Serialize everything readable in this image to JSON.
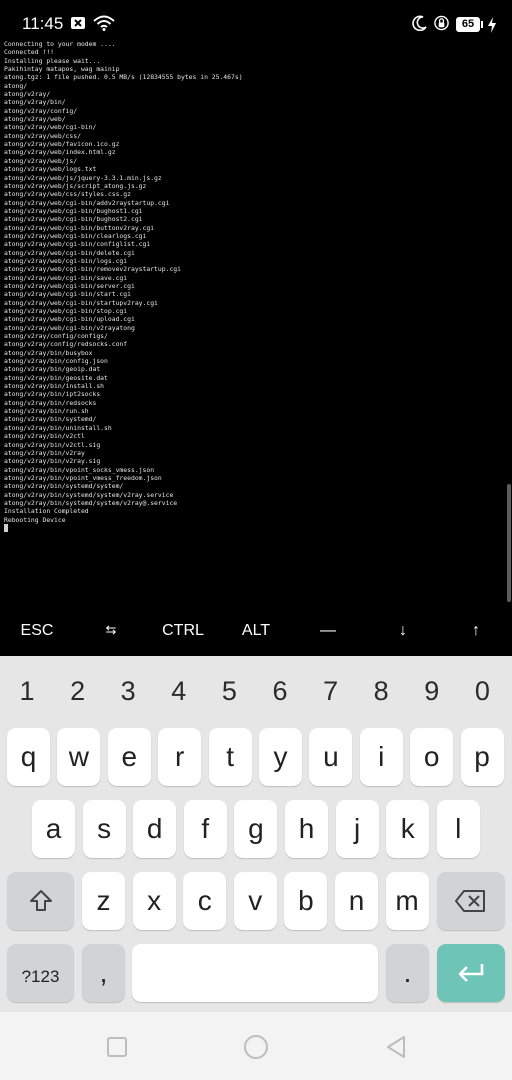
{
  "status_bar": {
    "time": "11:45",
    "battery": "65",
    "icons": [
      "sim-off-icon",
      "wifi-icon",
      "moon-icon",
      "rotation-lock-icon",
      "battery-icon",
      "charging-icon"
    ]
  },
  "terminal": {
    "lines": [
      "Connecting to your modem ....",
      "Connected !!!",
      "Installing please wait...",
      "Pakihintay matapos, wag mainip",
      "atong.tgz: 1 file pushed. 0.5 MB/s (12834555 bytes in 25.467s)",
      "atong/",
      "atong/v2ray/",
      "atong/v2ray/bin/",
      "atong/v2ray/config/",
      "atong/v2ray/web/",
      "atong/v2ray/web/cgi-bin/",
      "atong/v2ray/web/css/",
      "atong/v2ray/web/favicon.ico.gz",
      "atong/v2ray/web/index.html.gz",
      "atong/v2ray/web/js/",
      "atong/v2ray/web/logs.txt",
      "atong/v2ray/web/js/jquery-3.3.1.min.js.gz",
      "atong/v2ray/web/js/script_atong.js.gz",
      "atong/v2ray/web/css/styles.css.gz",
      "atong/v2ray/web/cgi-bin/addv2raystartup.cgi",
      "atong/v2ray/web/cgi-bin/bughost1.cgi",
      "atong/v2ray/web/cgi-bin/bughost2.cgi",
      "atong/v2ray/web/cgi-bin/buttonv2ray.cgi",
      "atong/v2ray/web/cgi-bin/clearlogs.cgi",
      "atong/v2ray/web/cgi-bin/configlist.cgi",
      "atong/v2ray/web/cgi-bin/delete.cgi",
      "atong/v2ray/web/cgi-bin/logs.cgi",
      "atong/v2ray/web/cgi-bin/removev2raystartup.cgi",
      "atong/v2ray/web/cgi-bin/save.cgi",
      "atong/v2ray/web/cgi-bin/server.cgi",
      "atong/v2ray/web/cgi-bin/start.cgi",
      "atong/v2ray/web/cgi-bin/startupv2ray.cgi",
      "atong/v2ray/web/cgi-bin/stop.cgi",
      "atong/v2ray/web/cgi-bin/upload.cgi",
      "atong/v2ray/web/cgi-bin/v2rayatong",
      "atong/v2ray/config/configs/",
      "atong/v2ray/config/redsocks.conf",
      "atong/v2ray/bin/busybox",
      "atong/v2ray/bin/config.json",
      "atong/v2ray/bin/geoip.dat",
      "atong/v2ray/bin/geosite.dat",
      "atong/v2ray/bin/install.sh",
      "atong/v2ray/bin/ipt2socks",
      "atong/v2ray/bin/redsocks",
      "atong/v2ray/bin/run.sh",
      "atong/v2ray/bin/systemd/",
      "atong/v2ray/bin/uninstall.sh",
      "atong/v2ray/bin/v2ctl",
      "atong/v2ray/bin/v2ctl.sig",
      "atong/v2ray/bin/v2ray",
      "atong/v2ray/bin/v2ray.sig",
      "atong/v2ray/bin/vpoint_socks_vmess.json",
      "atong/v2ray/bin/vpoint_vmess_freedom.json",
      "atong/v2ray/bin/systemd/system/",
      "atong/v2ray/bin/systemd/system/v2ray.service",
      "atong/v2ray/bin/systemd/system/v2ray@.service",
      "Installation Completed",
      "Rebooting Device"
    ]
  },
  "extra_keys": {
    "esc": "ESC",
    "tab": "⇆",
    "ctrl": "CTRL",
    "alt": "ALT",
    "dash": "—",
    "down": "↓",
    "up": "↑"
  },
  "keyboard": {
    "numbers": [
      "1",
      "2",
      "3",
      "4",
      "5",
      "6",
      "7",
      "8",
      "9",
      "0"
    ],
    "row1": [
      "q",
      "w",
      "e",
      "r",
      "t",
      "y",
      "u",
      "i",
      "o",
      "p"
    ],
    "row2": [
      "a",
      "s",
      "d",
      "f",
      "g",
      "h",
      "j",
      "k",
      "l"
    ],
    "row3": [
      "z",
      "x",
      "c",
      "v",
      "b",
      "n",
      "m"
    ],
    "symbols": "?123",
    "comma": ",",
    "period": ".",
    "colors": {
      "background": "#e6e6e6",
      "key": "#ffffff",
      "special_key": "#d2d3d5",
      "enter": "#6ec4b6"
    }
  },
  "nav_bar": {
    "icons": [
      "recents-icon",
      "home-icon",
      "back-icon"
    ]
  },
  "colors": {
    "terminal_bg": "#000000",
    "terminal_fg": "#e6e6e6"
  }
}
